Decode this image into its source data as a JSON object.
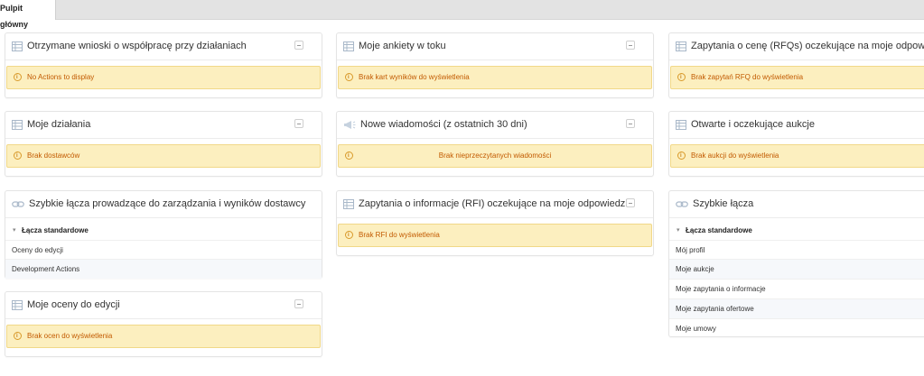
{
  "tabs": {
    "active": "Pulpit główny"
  },
  "panels": {
    "p1": {
      "title": "Otrzymane wnioski o współpracę przy działaniach",
      "message": "No Actions to display"
    },
    "p2": {
      "title": "Moje ankiety w toku",
      "message": "Brak kart wyników do wyświetlenia"
    },
    "p3": {
      "title": "Zapytania o cenę (RFQs) oczekujące na moje odpowiedzi",
      "message": "Brak zapytań RFQ do wyświetlenia"
    },
    "p4": {
      "title": "Moje działania",
      "message": "Brak dostawców"
    },
    "p5": {
      "title": "Nowe wiadomości (z ostatnich 30 dni)",
      "message": "Brak nieprzeczytanych wiadomości"
    },
    "p6": {
      "title": "Otwarte i oczekujące aukcje",
      "message": "Brak aukcji do wyświetlenia"
    },
    "p7": {
      "title": "Szybkie łącza prowadzące do zarządzania i wyników dostawcy",
      "group": "Łącza standardowe",
      "links": [
        "Oceny do edycji",
        "Development Actions"
      ]
    },
    "p8": {
      "title": "Zapytania o informacje (RFI) oczekujące na moje odpowiedzi",
      "message": "Brak RFI do wyświetlenia"
    },
    "p9": {
      "title": "Szybkie łącza",
      "group": "Łącza standardowe",
      "links": [
        "Mój profil",
        "Moje aukcje",
        "Moje zapytania o informacje",
        "Moje zapytania ofertowe",
        "Moje umowy"
      ]
    },
    "p10": {
      "title": "Moje oceny do edycji",
      "message": "Brak ocen do wyświetlenia"
    }
  },
  "icons": {
    "table": "table-icon",
    "megaphone": "megaphone-icon",
    "link": "link-icon",
    "collapse": "collapse-icon",
    "info": "info-icon"
  },
  "colors": {
    "alert_bg": "#fcefbf",
    "alert_text": "#c25a00",
    "tabbar": "#e3e3e3"
  }
}
